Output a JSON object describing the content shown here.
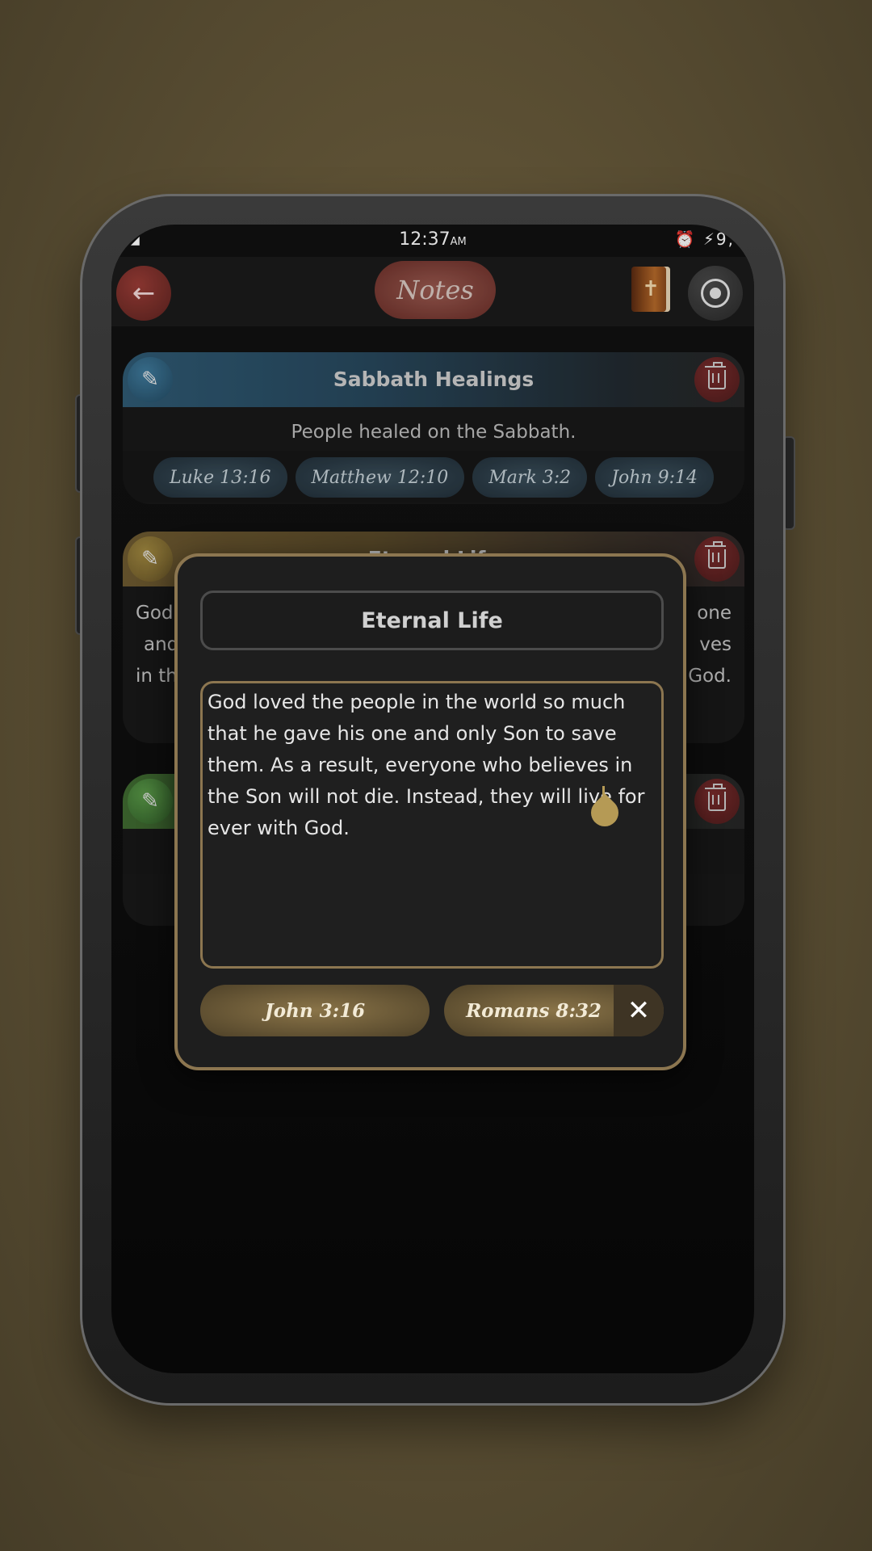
{
  "status": {
    "time": "12:37",
    "ampm": "AM",
    "left": "◢",
    "right": "⏰ ⚡9,"
  },
  "appbar": {
    "title": "Notes",
    "back_icon": "←",
    "bible_icon": "✝"
  },
  "notes": [
    {
      "title": "Sabbath Healings",
      "description": "People healed on the Sabbath.",
      "refs": [
        "Luke 13:16",
        "Matthew 12:10",
        "Mark 3:2",
        "John 9:14"
      ],
      "accent": "#3a6a8a"
    },
    {
      "title": "Eternal Life",
      "left_fragments": [
        "God",
        "and",
        "in th"
      ],
      "right_fragments": [
        "one",
        "ves",
        "God."
      ],
      "accent": "#8a7440"
    },
    {
      "title": "",
      "accent": "#3f7a36"
    }
  ],
  "dialog": {
    "title_value": "Eternal Life",
    "body_value": "God loved the people in the world so much that he gave his one and only Son to save them. As a result, everyone who believes in the Son will not die. Instead, they will live for ever with God.",
    "verses": [
      "John 3:16",
      "Romans 8:32"
    ],
    "close_icon": "✕"
  },
  "colors": {
    "accent_gold": "#8c7650",
    "danger": "#7a2c2c"
  }
}
